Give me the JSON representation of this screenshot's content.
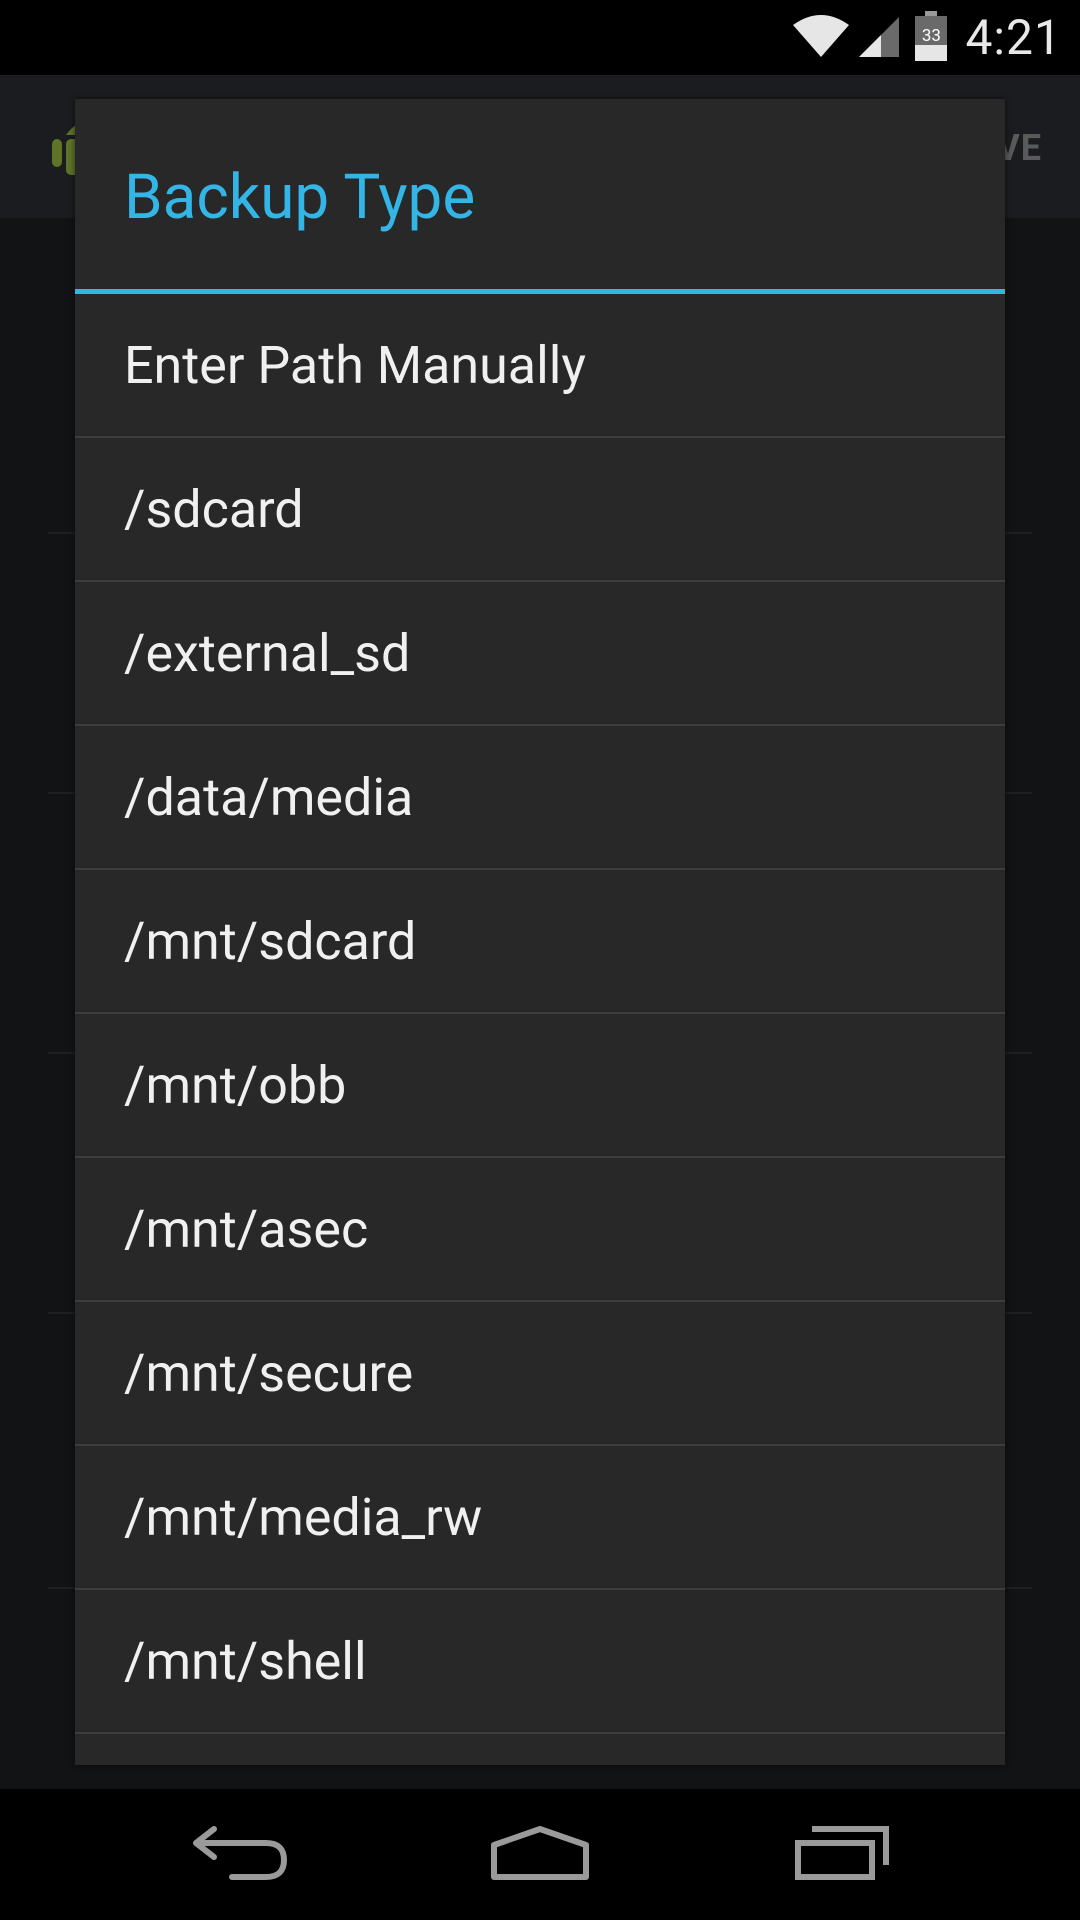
{
  "status_bar": {
    "time": "4:21",
    "battery_level": "33",
    "icons": [
      "wifi-icon",
      "cell-signal-icon",
      "battery-icon"
    ]
  },
  "background_app": {
    "action_label": "VE",
    "icon": "android-robot-icon"
  },
  "dialog": {
    "title": "Backup Type",
    "accent_color": "#33b5e5",
    "options": [
      "Enter Path Manually",
      "/sdcard",
      "/external_sd",
      "/data/media",
      "/mnt/sdcard",
      "/mnt/obb",
      "/mnt/asec",
      "/mnt/secure",
      "/mnt/media_rw",
      "/mnt/shell"
    ]
  },
  "nav_bar": {
    "buttons": [
      "back-icon",
      "home-icon",
      "recent-apps-icon"
    ]
  }
}
